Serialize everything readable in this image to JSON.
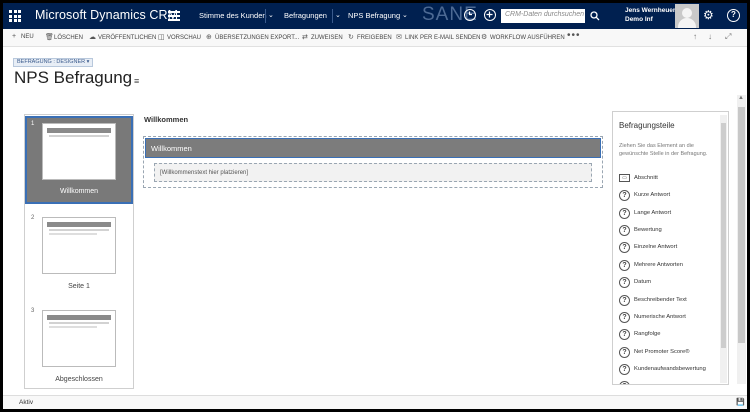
{
  "topbar": {
    "brand": "Microsoft Dynamics CRM",
    "nav_area": "Stimme des Kunden",
    "nav_entity": "Befragungen",
    "nav_record": "NPS Befragung",
    "watermark": "SANE",
    "search_placeholder": "CRM-Daten durchsuchen",
    "user_name": "Jens Wernheuer",
    "user_org": "Demo Inf"
  },
  "commands": [
    {
      "icon": "plus-icon",
      "label": "NEU"
    },
    {
      "icon": "trash-icon",
      "label": "LÖSCHEN"
    },
    {
      "icon": "cloud-upload-icon",
      "label": "VERÖFFENTLICHEN"
    },
    {
      "icon": "preview-icon",
      "label": "VORSCHAU"
    },
    {
      "icon": "translate-icon",
      "label": "ÜBERSETZUNGEN EXPORT..."
    },
    {
      "icon": "assign-icon",
      "label": "ZUWEISEN"
    },
    {
      "icon": "share-icon",
      "label": "FREIGEBEN"
    },
    {
      "icon": "email-link-icon",
      "label": "LINK PER E-MAIL SENDEN"
    },
    {
      "icon": "workflow-icon",
      "label": "WORKFLOW AUSFÜHREN"
    }
  ],
  "more_label": "•••",
  "header": {
    "form_selector": "BEFRAGUNG : DESIGNER",
    "title": "NPS Befragung"
  },
  "pages": [
    {
      "num": "1",
      "name": "Willkommen",
      "selected": true
    },
    {
      "num": "2",
      "name": "Seite 1",
      "selected": false
    },
    {
      "num": "3",
      "name": "Abgeschlossen",
      "selected": false
    }
  ],
  "canvas": {
    "page_title": "Willkommen",
    "section_header": "Willkommen",
    "placeholder": "[Willkommenstext hier platzieren]"
  },
  "parts": {
    "title": "Befragungsteile",
    "hint": "Ziehen Sie das Element an die gewünschte Stelle in der Befragung.",
    "items": [
      {
        "icon": "section-icon",
        "label": "Abschnitt"
      },
      {
        "icon": "question-icon",
        "label": "Kurze Antwort"
      },
      {
        "icon": "question-icon",
        "label": "Lange Antwort"
      },
      {
        "icon": "question-icon",
        "label": "Bewertung"
      },
      {
        "icon": "question-icon",
        "label": "Einzelne Antwort"
      },
      {
        "icon": "question-icon",
        "label": "Mehrere Antworten"
      },
      {
        "icon": "question-icon",
        "label": "Datum"
      },
      {
        "icon": "question-icon",
        "label": "Beschreibender Text"
      },
      {
        "icon": "question-icon",
        "label": "Numerische Antwort"
      },
      {
        "icon": "question-icon",
        "label": "Rangfolge"
      },
      {
        "icon": "question-icon",
        "label": "Net Promoter Score®"
      },
      {
        "icon": "question-icon",
        "label": "Kundenaufwandsbewertung"
      }
    ]
  },
  "status": {
    "state": "Aktiv"
  }
}
